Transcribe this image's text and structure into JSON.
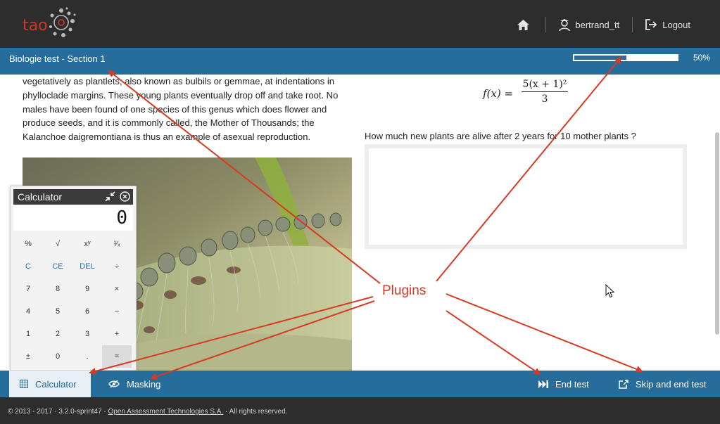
{
  "header": {
    "logo_text": "tao",
    "home_icon": "home-icon",
    "user_icon": "user-icon",
    "username": "bertrand_tt",
    "logout_icon": "logout-icon",
    "logout_label": "Logout"
  },
  "titlebar": {
    "title": "Biologie test - Section 1",
    "progress_fraction": 0.5,
    "progress_label": "50%"
  },
  "passage": {
    "text": "vegetatively as plantlets, also known as bulbils or gemmae, at indentations in phylloclade margins. These young plants eventually drop off and take root. No males have been found of one species of this genus which does flower and produce seeds, and it is commonly called, the Mother of Thousands; the Kalanchoe daigremontiana is thus an example of asexual reproduction."
  },
  "formula": {
    "lhs": "f(x) =",
    "numerator": "5(x + 1)²",
    "denominator": "3"
  },
  "question": {
    "prompt": "How much new plants are alive after 2 years for 10 mother plants ?",
    "answer_value": ""
  },
  "calculator": {
    "title": "Calculator",
    "display": "0",
    "minimize_icon": "compress-icon",
    "close_icon": "close-icon",
    "keys": [
      {
        "label": "%",
        "name": "percent"
      },
      {
        "label": "√",
        "name": "sqrt"
      },
      {
        "label": "xʸ",
        "name": "power"
      },
      {
        "label": "¹⁄ₓ",
        "name": "reciprocal"
      },
      {
        "label": "C",
        "name": "clear",
        "style": "blue"
      },
      {
        "label": "CE",
        "name": "clear-entry",
        "style": "blue"
      },
      {
        "label": "DEL",
        "name": "delete",
        "style": "blue"
      },
      {
        "label": "÷",
        "name": "divide"
      },
      {
        "label": "7",
        "name": "7"
      },
      {
        "label": "8",
        "name": "8"
      },
      {
        "label": "9",
        "name": "9"
      },
      {
        "label": "×",
        "name": "multiply"
      },
      {
        "label": "4",
        "name": "4"
      },
      {
        "label": "5",
        "name": "5"
      },
      {
        "label": "6",
        "name": "6"
      },
      {
        "label": "−",
        "name": "subtract"
      },
      {
        "label": "1",
        "name": "1"
      },
      {
        "label": "2",
        "name": "2"
      },
      {
        "label": "3",
        "name": "3"
      },
      {
        "label": "+",
        "name": "add"
      },
      {
        "label": "±",
        "name": "negate"
      },
      {
        "label": "0",
        "name": "0"
      },
      {
        "label": ".",
        "name": "decimal"
      },
      {
        "label": "=",
        "name": "equals",
        "style": "eq"
      }
    ]
  },
  "toolbar": {
    "calculator_label": "Calculator",
    "calculator_icon": "calculator-icon",
    "masking_label": "Masking",
    "masking_icon": "eye-slash-icon",
    "end_test_label": "End test",
    "end_test_icon": "fast-forward-icon",
    "skip_end_label": "Skip and end test",
    "skip_end_icon": "external-link-icon"
  },
  "footer": {
    "prefix": "© 2013 - 2017 · 3.2.0-sprint47 · ",
    "link": "Open Assessment Technologies S.A.",
    "suffix": " · All rights reserved."
  },
  "annotation": {
    "label": "Plugins",
    "color": "#d73a22"
  },
  "colors": {
    "header_bg": "#2d2d2d",
    "accent_blue": "#266d9c",
    "logo_red": "#d2342a"
  }
}
